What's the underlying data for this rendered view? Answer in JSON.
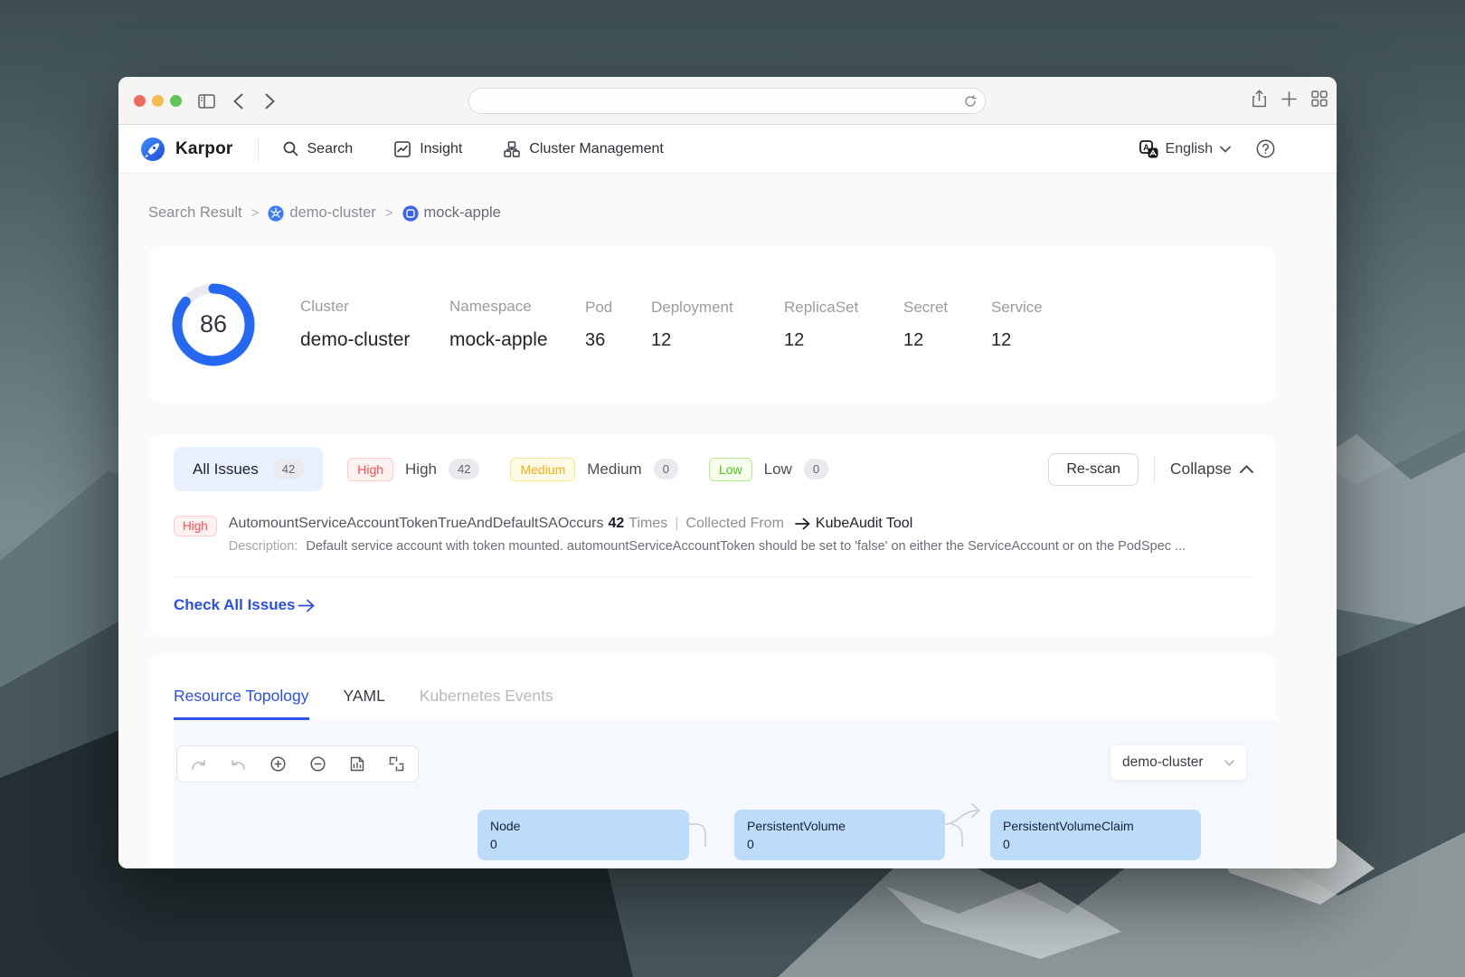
{
  "browser": {
    "address_value": ""
  },
  "app_header": {
    "brand": "Karpor",
    "nav": [
      {
        "label": "Search"
      },
      {
        "label": "Insight"
      },
      {
        "label": "Cluster Management"
      }
    ],
    "language": {
      "label": "English"
    }
  },
  "breadcrumb": {
    "separator": ">",
    "items": [
      {
        "label": "Search Result"
      },
      {
        "label": "demo-cluster"
      },
      {
        "label": "mock-apple"
      }
    ]
  },
  "overview": {
    "score": "86",
    "stats": [
      {
        "label": "Cluster",
        "value": "demo-cluster"
      },
      {
        "label": "Namespace",
        "value": "mock-apple"
      },
      {
        "label": "Pod",
        "value": "36"
      },
      {
        "label": "Deployment",
        "value": "12"
      },
      {
        "label": "ReplicaSet",
        "value": "12"
      },
      {
        "label": "Secret",
        "value": "12"
      },
      {
        "label": "Service",
        "value": "12"
      }
    ]
  },
  "issues": {
    "all_filter": {
      "label": "All Issues",
      "count": "42"
    },
    "severity_filters": [
      {
        "tag": "High",
        "label": "High",
        "count": "42"
      },
      {
        "tag": "Medium",
        "label": "Medium",
        "count": "0"
      },
      {
        "tag": "Low",
        "label": "Low",
        "count": "0"
      }
    ],
    "rescan_button": "Re-scan",
    "collapse_label": "Collapse",
    "issue_row": {
      "severity": "High",
      "title": "AutomountServiceAccountTokenTrueAndDefaultSA",
      "occurs_label": "Occurs",
      "count": "42",
      "count_suffix": "Times",
      "pipe": "|",
      "collected_from_label": "Collected From",
      "source": "KubeAudit Tool",
      "description_label": "Description:",
      "description_text": "Default service account with token mounted. automountServiceAccountToken should be set to 'false' on either the ServiceAccount or on the PodSpec ..."
    },
    "check_all_link": "Check All Issues"
  },
  "detail_tabs": [
    {
      "label": "Resource Topology",
      "active": true
    },
    {
      "label": "YAML",
      "active": false
    },
    {
      "label": "Kubernetes Events",
      "active": false
    }
  ],
  "topology": {
    "cluster_selector": "demo-cluster",
    "nodes": [
      {
        "name": "Node",
        "count": "0"
      },
      {
        "name": "PersistentVolume",
        "count": "0"
      },
      {
        "name": "PersistentVolumeClaim",
        "count": "0"
      }
    ]
  },
  "colors": {
    "accent_blue": "#2a4fe4",
    "score_ring_blue": "#2567f1",
    "high_red": "#ff4d4f",
    "medium_yellow": "#faad14",
    "low_green": "#52c41a",
    "selected_filter_bg": "#e8f1fd",
    "topology_node_fill": "#bcdcfa",
    "canvas_bg": "#f5f8fd"
  }
}
